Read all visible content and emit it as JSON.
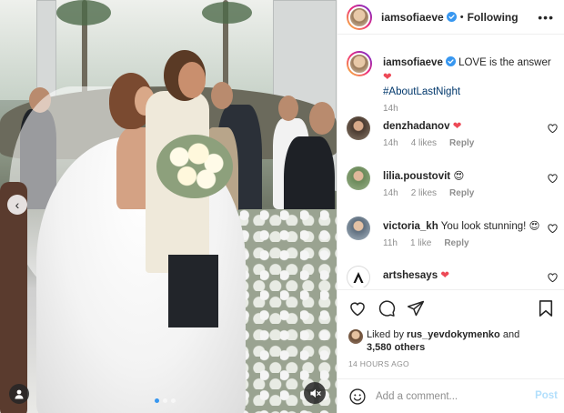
{
  "post": {
    "username": "iamsofiaeve",
    "follow_status": "Following",
    "separator": "•",
    "more_glyph": "•••"
  },
  "caption": {
    "username": "iamsofiaeve",
    "text": "LOVE is the answer",
    "emoji": "❤",
    "hashtag": "#AboutLastNight",
    "time": "14h"
  },
  "comments": [
    {
      "username": "denzhadanov",
      "text": "",
      "emoji": "❤",
      "time": "14h",
      "likes": "4 likes",
      "reply": "Reply"
    },
    {
      "username": "lilia.poustovit",
      "text": "",
      "emoji": "😍",
      "time": "14h",
      "likes": "2 likes",
      "reply": "Reply"
    },
    {
      "username": "victoria_kh",
      "text": "You look stunning!",
      "emoji": "😍",
      "time": "11h",
      "likes": "1 like",
      "reply": "Reply"
    },
    {
      "username": "artshesays",
      "text": "",
      "emoji": "❤",
      "time": "",
      "likes": "",
      "reply": ""
    }
  ],
  "likes": {
    "prefix": "Liked by",
    "user": "rus_yevdokymenko",
    "and": "and",
    "count": "3,580 others"
  },
  "timeago": "14 HOURS AGO",
  "composer": {
    "placeholder": "Add a comment...",
    "post_label": "Post"
  },
  "media": {
    "prev_glyph": "‹",
    "carousel_dots": 3,
    "active_dot": 0
  },
  "colors": {
    "accent": "#3897f0",
    "link": "#00376b",
    "heart": "#ed4956",
    "post_disabled": "#b2dffc"
  }
}
